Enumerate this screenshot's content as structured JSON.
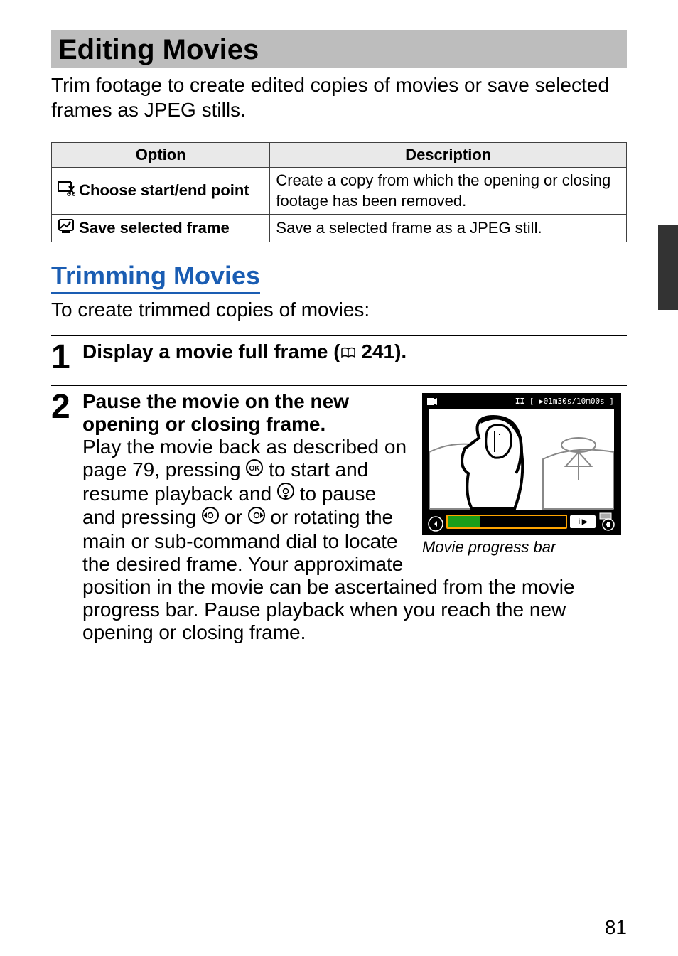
{
  "section": {
    "title": "Editing Movies",
    "intro": "Trim footage to create edited copies of movies or save selected frames as JPEG stills."
  },
  "table": {
    "header_option": "Option",
    "header_description": "Description",
    "rows": [
      {
        "icon": "trim-icon",
        "label": "Choose start/end point",
        "desc": "Create a copy from which the opening or closing footage has been removed."
      },
      {
        "icon": "frame-save-icon",
        "label": "Save selected frame",
        "desc": "Save a selected frame as a JPEG still."
      }
    ]
  },
  "subheading": {
    "title": "Trimming Movies",
    "desc": "To create trimmed copies of movies:"
  },
  "steps": {
    "s1": {
      "num": "1",
      "title_pre": "Display a movie full frame (",
      "page_ref": " 241).",
      "body": ""
    },
    "s2": {
      "num": "2",
      "title": "Pause the movie on the new opening or closing frame.",
      "body_1": "Play the movie back as described on page 79, pressing ",
      "body_2": " to start and resume playback and ",
      "body_3": " to pause and pressing ",
      "body_4": " or ",
      "body_5": " or rotating the main or sub-command dial to locate the desired frame.  Your approximate position in the movie can be ascertained from the movie progress bar.  Pause playback when you reach the new opening or closing frame."
    }
  },
  "figure": {
    "overlay": "[ ▶01m30s/10m00s ]",
    "pause_glyph": "II",
    "badge": "i ▶",
    "caption": "Movie progress bar"
  },
  "page_number": "81"
}
